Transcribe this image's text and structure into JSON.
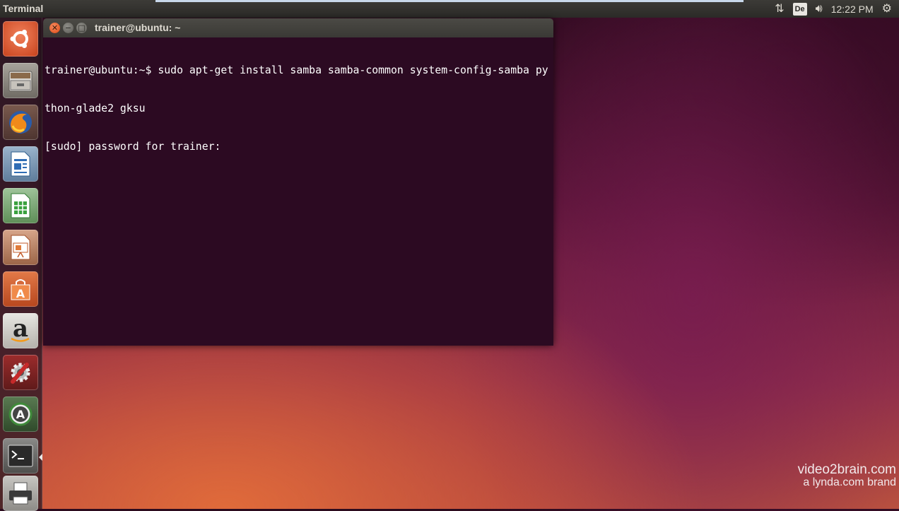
{
  "panel": {
    "app_title": "Terminal",
    "keyboard_layout": "De",
    "clock": "12:22 PM",
    "icons": [
      "network-arrows-icon",
      "keyboard-layout-icon",
      "volume-icon",
      "gear-icon"
    ]
  },
  "launcher": {
    "items": [
      {
        "name": "dash-ubuntu-icon"
      },
      {
        "name": "files-icon"
      },
      {
        "name": "firefox-icon"
      },
      {
        "name": "libreoffice-writer-icon"
      },
      {
        "name": "libreoffice-calc-icon"
      },
      {
        "name": "libreoffice-impress-icon"
      },
      {
        "name": "software-center-icon"
      },
      {
        "name": "amazon-icon"
      },
      {
        "name": "system-settings-icon"
      },
      {
        "name": "software-updater-icon"
      },
      {
        "name": "terminal-icon"
      },
      {
        "name": "printer-icon"
      }
    ],
    "amazon_letter": "a"
  },
  "terminal": {
    "title": "trainer@ubuntu: ~",
    "lines": [
      "trainer@ubuntu:~$ sudo apt-get install samba samba-common system-config-samba py",
      "thon-glade2 gksu",
      "[sudo] password for trainer: "
    ],
    "colors": {
      "background": "#2c0a22",
      "text": "#ffffff"
    }
  },
  "watermark": {
    "brand": "video2brain.com",
    "sub": "a lynda.com brand"
  }
}
